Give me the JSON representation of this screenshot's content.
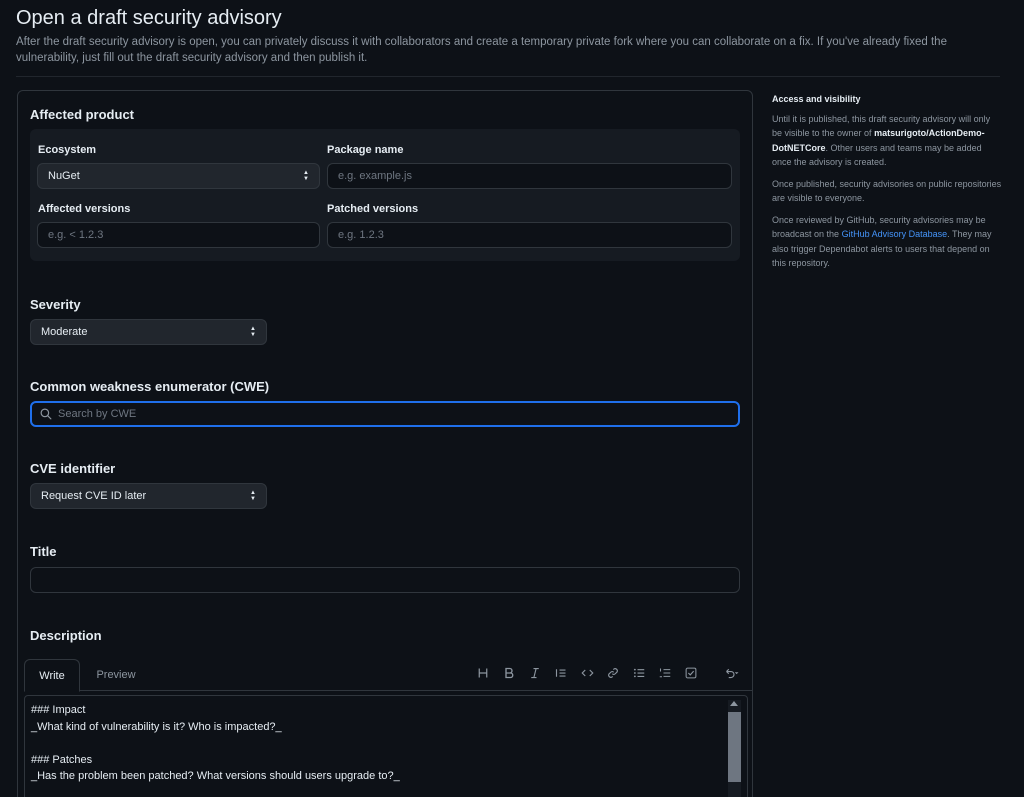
{
  "header": {
    "title": "Open a draft security advisory",
    "description": "After the draft security advisory is open, you can privately discuss it with collaborators and create a temporary private fork where you can collaborate on a fix. If you've already fixed the vulnerability, just fill out the draft security advisory and then publish it."
  },
  "affected_product": {
    "title": "Affected product",
    "ecosystem_label": "Ecosystem",
    "ecosystem_value": "NuGet",
    "package_label": "Package name",
    "package_placeholder": "e.g. example.js",
    "affected_label": "Affected versions",
    "affected_placeholder": "e.g. < 1.2.3",
    "patched_label": "Patched versions",
    "patched_placeholder": "e.g. 1.2.3"
  },
  "severity": {
    "title": "Severity",
    "value": "Moderate"
  },
  "cwe": {
    "title": "Common weakness enumerator (CWE)",
    "placeholder": "Search by CWE"
  },
  "cve": {
    "title": "CVE identifier",
    "value": "Request CVE ID later"
  },
  "title_field": {
    "title": "Title",
    "value": ""
  },
  "description": {
    "title": "Description",
    "tab_write": "Write",
    "tab_preview": "Preview",
    "toolbar_icons": [
      "heading-icon",
      "bold-icon",
      "italic-icon",
      "quote-icon",
      "code-icon",
      "link-icon",
      "unordered-list-icon",
      "ordered-list-icon",
      "task-list-icon",
      "undo-icon"
    ],
    "lines": [
      "### Impact",
      "_What kind of vulnerability is it? Who is impacted?_",
      "",
      "### Patches",
      "_Has the problem been patched? What versions should users upgrade to?_"
    ]
  },
  "sidebar": {
    "heading": "Access and visibility",
    "p1_before": "Until it is published, this draft security advisory will only be visible to the owner of ",
    "p1_repo": "matsurigoto/ActionDemo-DotNETCore",
    "p1_after": ". Other users and teams may be added once the advisory is created.",
    "p2": "Once published, security advisories on public repositories are visible to everyone.",
    "p3_before": "Once reviewed by GitHub, security advisories may be broadcast on the ",
    "p3_link": "GitHub Advisory Database",
    "p3_after": ". They may also trigger Dependabot alerts to users that depend on this repository."
  },
  "colors": {
    "background": "#0d1117",
    "accent_focus": "#1f6feb",
    "link": "#4493f8",
    "muted_text": "#8d96a0"
  }
}
